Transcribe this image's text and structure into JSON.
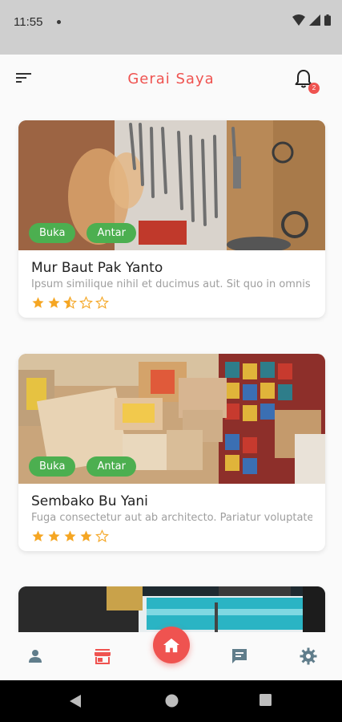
{
  "status_bar": {
    "time": "11:55"
  },
  "app_bar": {
    "title": "Gerai Saya",
    "notification_count": "2"
  },
  "stores": [
    {
      "name": "Mur Baut Pak Yanto",
      "description": "Ipsum similique nihil et ducimus aut. Sit quo in omnis quia.",
      "tags": [
        "Buka",
        "Antar"
      ],
      "rating": 2.5,
      "photo": "hardware-tools-wall"
    },
    {
      "name": "Sembako Bu Yani",
      "description": "Fuga consectetur aut ab architecto. Pariatur voluptate et.",
      "tags": [
        "Buka",
        "Antar"
      ],
      "rating": 4,
      "photo": "grocery-boxes"
    },
    {
      "photo": "store-interior"
    }
  ],
  "bottom_nav": [
    "profile-icon",
    "store-icon",
    "home-icon",
    "chat-icon",
    "settings-icon"
  ],
  "colors": {
    "accent": "#ef5350",
    "tag": "#4caf50",
    "star": "#f5a623",
    "nav_icon": "#607d8b"
  }
}
